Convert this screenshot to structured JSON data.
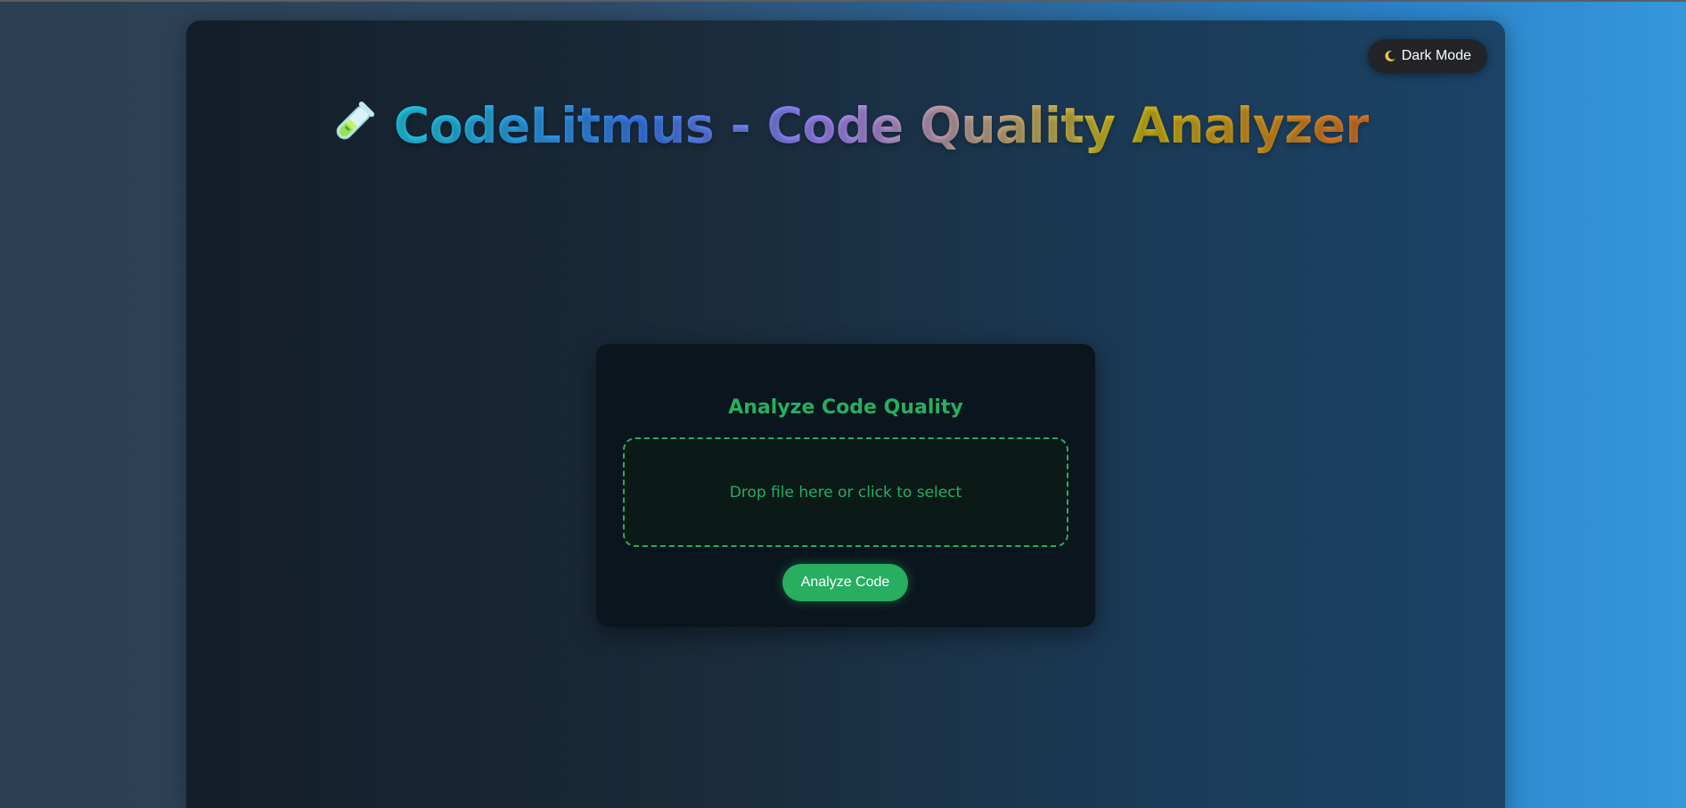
{
  "theme_toggle": {
    "icon": "crescent-moon-icon",
    "label": "Dark Mode"
  },
  "header": {
    "icon": "test-tube-icon",
    "title": "CodeLitmus - Code Quality Analyzer"
  },
  "analyzer_card": {
    "title": "Analyze Code Quality",
    "drop_zone_text": "Drop file here or click to select",
    "analyze_button_label": "Analyze Code"
  },
  "colors": {
    "accent": "#27ae60",
    "toggle_background": "#222427",
    "card_background": "#0b151d"
  }
}
